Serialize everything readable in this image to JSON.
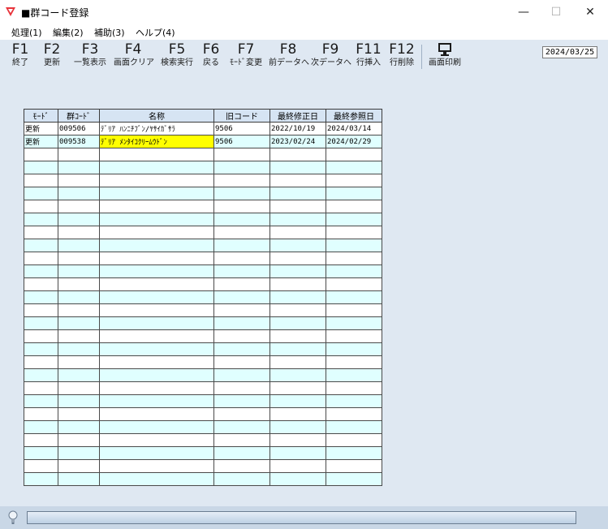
{
  "window": {
    "title": "■群コード登録",
    "minimize": "—",
    "maximize": "☐",
    "close": "✕"
  },
  "menu": [
    "処理(1)",
    "編集(2)",
    "補助(3)",
    "ヘルプ(4)"
  ],
  "toolbar": {
    "fkeys": [
      {
        "key": "F1",
        "label": "終了"
      },
      {
        "key": "F2",
        "label": "更新"
      },
      {
        "key": "F3",
        "label": "一覧表示"
      },
      {
        "key": "F4",
        "label": "画面クリア"
      },
      {
        "key": "F5",
        "label": "検索実行"
      },
      {
        "key": "F6",
        "label": "戻る"
      },
      {
        "key": "F7",
        "label": "ﾓｰﾄﾞ変更"
      },
      {
        "key": "F8",
        "label": "前データへ"
      },
      {
        "key": "F9",
        "label": "次データへ"
      },
      {
        "key": "F11",
        "label": "行挿入"
      },
      {
        "key": "F12",
        "label": "行削除"
      }
    ],
    "print_label": "画面印刷",
    "date": "2024/03/25"
  },
  "grid": {
    "headers": [
      "ﾓｰﾄﾞ",
      "群ｺｰﾄﾞ",
      "名称",
      "旧コード",
      "最終修正日",
      "最終参照日"
    ],
    "rows": [
      [
        "更新",
        "009506",
        "ﾃﾞﾘｱ ﾊﾝﾆﾁﾌﾞﾝ/ﾔｻｲｶﾞｻﾗ",
        "9506",
        "2022/10/19",
        "2024/03/14"
      ],
      [
        "更新",
        "009538",
        "ﾃﾞﾘｱ ﾒﾝﾀｲｺｸﾘｰﾑｳﾄﾞﾝ",
        "9506",
        "2023/02/24",
        "2024/02/29"
      ]
    ],
    "total_rows": 28
  }
}
